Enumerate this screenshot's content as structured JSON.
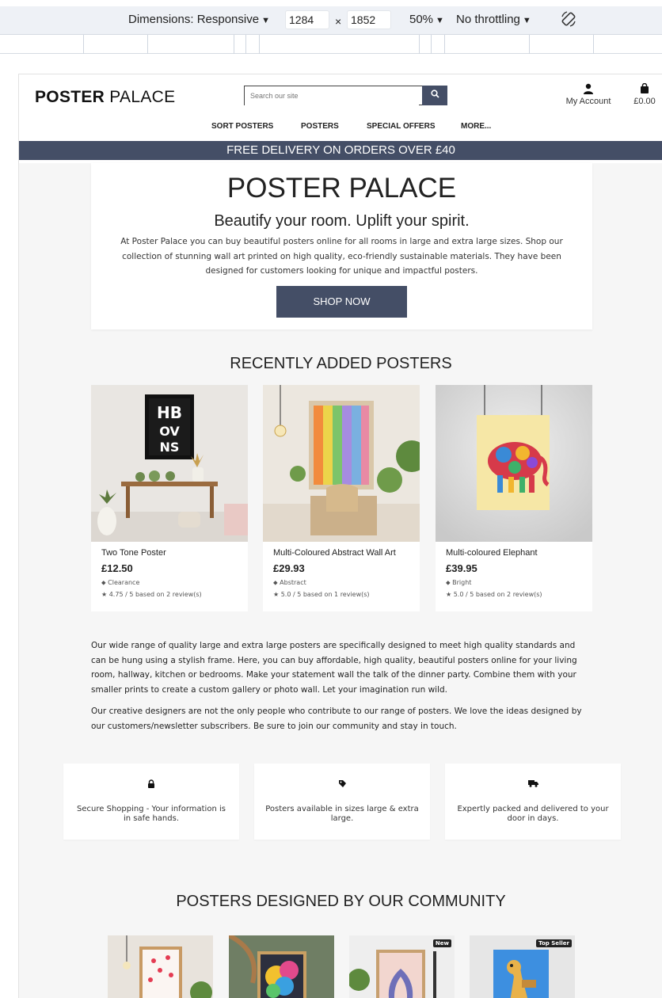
{
  "devtools": {
    "dimensions": "Dimensions: Responsive",
    "width": "1284",
    "times": "×",
    "height": "1852",
    "zoom": "50%",
    "throttle": "No throttling"
  },
  "header": {
    "logo_bold": "POSTER",
    "logo_light": " PALACE",
    "search_placeholder": "Search our site",
    "account_label": "My Account",
    "bag_total": "£0.00",
    "nav": [
      "SORT POSTERS",
      "POSTERS",
      "SPECIAL OFFERS",
      "MORE..."
    ],
    "banner": "FREE DELIVERY ON ORDERS OVER £40"
  },
  "hero": {
    "title": "POSTER PALACE",
    "subtitle": "Beautify your room. Uplift your spirit.",
    "text": "At Poster Palace you can buy beautiful posters online for all rooms in large and extra large sizes. Shop our collection of stunning wall art printed on high quality, eco-friendly sustainable materials. They have been designed for customers looking for unique and impactful posters.",
    "button": "SHOP NOW"
  },
  "recent": {
    "title": "RECENTLY ADDED POSTERS",
    "products": [
      {
        "name": "Two Tone Poster",
        "price": "£12.50",
        "category": "Clearance",
        "rating": "4.75 / 5 based on 2 review(s)"
      },
      {
        "name": "Multi-Coloured Abstract Wall Art",
        "price": "£29.93",
        "category": "Abstract",
        "rating": "5.0 / 5 based on 1 review(s)"
      },
      {
        "name": "Multi-coloured Elephant",
        "price": "£39.95",
        "category": "Bright",
        "rating": "5.0 / 5 based on 2 review(s)"
      }
    ]
  },
  "about": {
    "p1": "Our wide range of quality large and extra large posters are specifically designed to meet high quality standards and can be hung using a stylish frame. Here, you can buy affordable, high quality, beautiful posters online for your living room, hallway, kitchen or bedrooms. Make your statement wall the talk of the dinner party. Combine them with your smaller prints to create a custom gallery or photo wall. Let your imagination run wild.",
    "p2": "Our creative designers are not the only people who contribute to our range of posters. We love the ideas designed by our customers/newsletter subscribers. Be sure to join our community and stay in touch."
  },
  "features": [
    {
      "icon": "lock-icon",
      "text": "Secure Shopping - Your information is in safe hands."
    },
    {
      "icon": "tag-icon",
      "text": "Posters available in sizes large & extra large."
    },
    {
      "icon": "truck-icon",
      "text": "Expertly packed and delivered to your door in days."
    }
  ],
  "community": {
    "title": "POSTERS DESIGNED BY OUR COMMUNITY",
    "badges": [
      "New",
      "Top Seller"
    ]
  },
  "colors": {
    "brand": "#444e66",
    "background": "#f6f6f6"
  }
}
